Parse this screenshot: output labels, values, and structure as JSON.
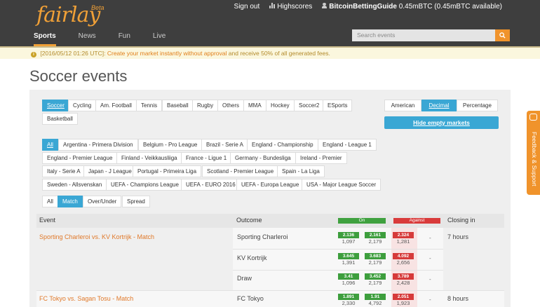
{
  "header": {
    "logo_text": "fairlay",
    "logo_beta": "Beta",
    "sign_out": "Sign out",
    "highscores": "Highscores",
    "username": "BitcoinBettingGuide",
    "balance": "0.45mBTC (0.45mBTC available)",
    "nav": [
      "Sports",
      "News",
      "Fun",
      "Live"
    ],
    "search_placeholder": "Search events"
  },
  "notice": {
    "date": "[2016/05/12 01:26 UTC]:",
    "link": "Create your market instantly without approval",
    "rest": "and receive 50% of all generated fees."
  },
  "page_title": "Soccer events",
  "sports": [
    "Soccer",
    "Cycling",
    "Am. Football",
    "Tennis",
    "Baseball",
    "Rugby",
    "Others",
    "MMA",
    "Hockey",
    "Soccer2",
    "ESports",
    "Basketball"
  ],
  "odds_format": [
    "American",
    "Decimal",
    "Percentage"
  ],
  "hide_empty": "Hide empty markets",
  "leagues": [
    "All",
    "Argentina - Primera Division",
    "Belgium - Pro League",
    "Brazil - Serie A",
    "England - Championship",
    "England - League 1",
    "England - Premier League",
    "Finland - Veikkausliiga",
    "France - Ligue 1",
    "Germany - Bundesliga",
    "Ireland - Premier",
    "Italy - Serie A",
    "Japan - J League",
    "Portugal - Primeira Liga",
    "Scotland - Premier League",
    "Spain - La Liga",
    "Sweden - Allsvenskan",
    "UEFA - Champions League",
    "UEFA - EURO 2016",
    "UEFA - Europa League",
    "USA - Major League Soccer"
  ],
  "market_types": [
    "All",
    "Match",
    "Over/Under",
    "Spread"
  ],
  "table": {
    "headers": {
      "event": "Event",
      "outcome": "Outcome",
      "on": "On",
      "against": "Against",
      "closing": "Closing in"
    },
    "events": [
      {
        "name": "Sporting Charleroi vs. KV Kortrijk - Match",
        "closing": "7 hours",
        "outcomes": [
          {
            "name": "Sporting Charleroi",
            "on1": "2.136",
            "on1v": "1,097",
            "on2": "2.161",
            "on2v": "2,179",
            "ag": "2.324",
            "agv": "1,281",
            "dash": "-"
          },
          {
            "name": "KV Kortrijk",
            "on1": "3.645",
            "on1v": "1,391",
            "on2": "3.683",
            "on2v": "2,179",
            "ag": "4.092",
            "agv": "2,656",
            "dash": "-"
          },
          {
            "name": "Draw",
            "on1": "3.41",
            "on1v": "1,096",
            "on2": "3.452",
            "on2v": "2,179",
            "ag": "3.789",
            "agv": "2,428",
            "dash": "-"
          }
        ]
      },
      {
        "name": "FC Tokyo vs. Sagan Tosu - Match",
        "closing": "8 hours",
        "outcomes": [
          {
            "name": "FC Tokyo",
            "on1": "1.891",
            "on1v": "2,330",
            "on2": "1.91",
            "on2v": "4,792",
            "ag": "2.051",
            "agv": "1,923",
            "dash": "-"
          }
        ]
      }
    ]
  },
  "feedback": "Feedback & Support"
}
